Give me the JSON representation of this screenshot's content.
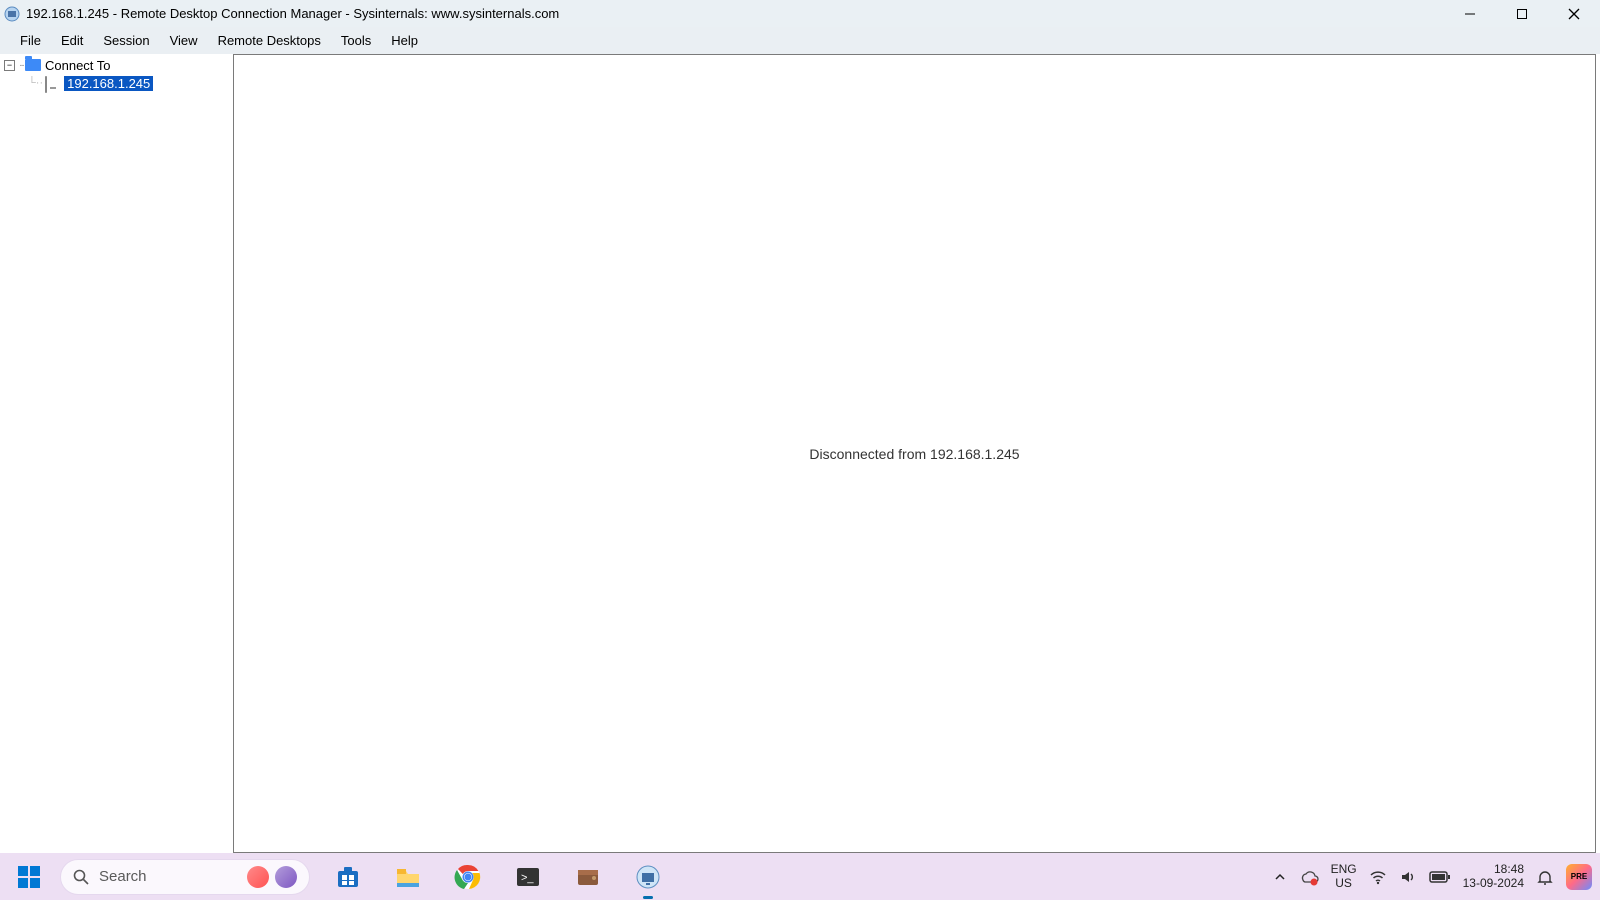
{
  "window": {
    "title": "192.168.1.245 - Remote Desktop Connection Manager - Sysinternals: www.sysinternals.com"
  },
  "menu": {
    "items": [
      "File",
      "Edit",
      "Session",
      "View",
      "Remote Desktops",
      "Tools",
      "Help"
    ]
  },
  "tree": {
    "root_label": "Connect To",
    "child_label": "192.168.1.245"
  },
  "content": {
    "status": "Disconnected from 192.168.1.245"
  },
  "taskbar": {
    "search_placeholder": "Search",
    "lang_line1": "ENG",
    "lang_line2": "US",
    "time": "18:48",
    "date": "13-09-2024",
    "copilot_tag": "PRE"
  }
}
